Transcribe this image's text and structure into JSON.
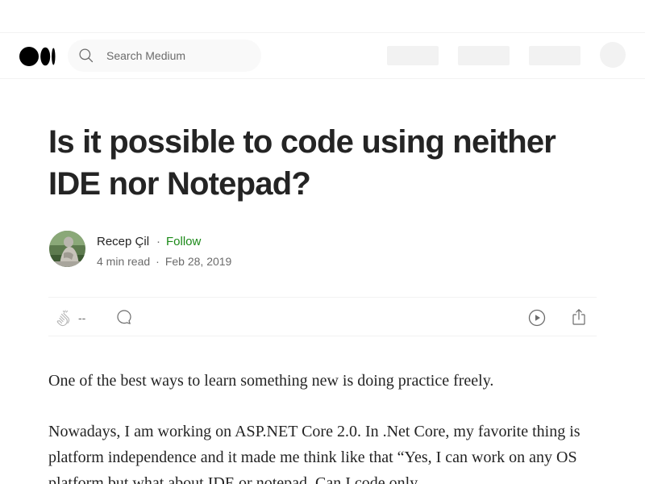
{
  "navbar": {
    "logo_icon": "medium-logo-icon",
    "search_placeholder": "Search Medium",
    "search_icon": "search-icon"
  },
  "article": {
    "title": "Is it possible to code using neither IDE nor Notepad?",
    "author": {
      "name": "Recep Çil",
      "separator": "·",
      "follow_label": "Follow",
      "avatar_icon": "author-avatar"
    },
    "meta": {
      "read_time": "4 min read",
      "separator": "·",
      "date": "Feb 28, 2019"
    },
    "actions": {
      "clap_count": "--",
      "clap_icon": "clap-icon",
      "respond_icon": "comment-icon",
      "listen_icon": "play-icon",
      "share_icon": "share-icon"
    },
    "paragraphs": [
      "One of the best ways to learn something new is doing practice freely.",
      "Nowadays, I am working on ASP.NET Core 2.0. In .Net Core, my favorite thing is platform independence and it made me think like that “Yes, I can work on any OS platform but what about IDE or notepad. Can I code only"
    ]
  },
  "colors": {
    "text": "#242424",
    "muted": "#6b6b6b",
    "follow_green": "#1a8917",
    "placeholder_gray": "#f2f2f2"
  }
}
